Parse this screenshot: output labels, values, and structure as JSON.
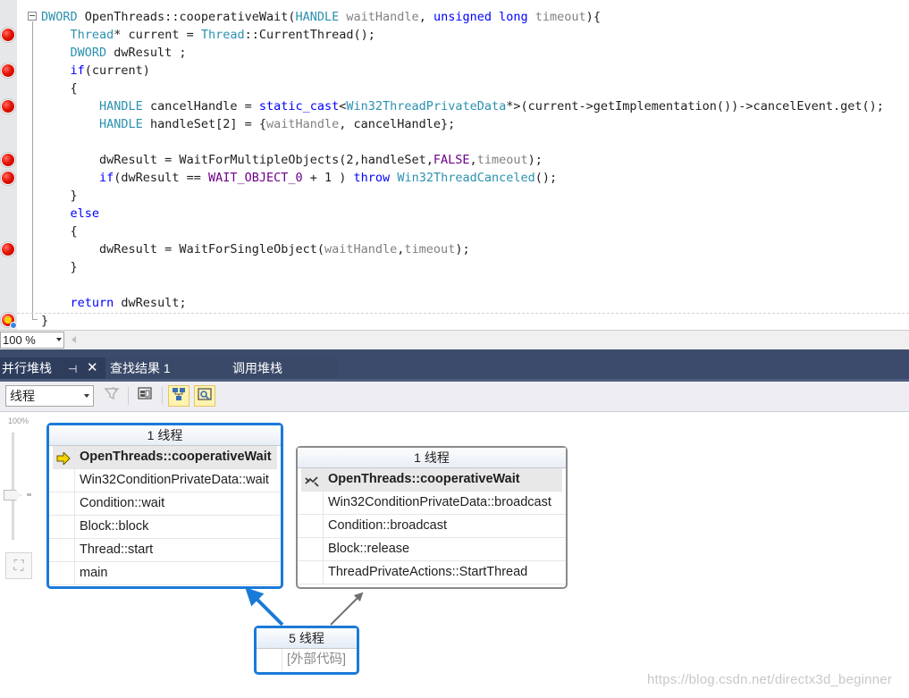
{
  "editor": {
    "lines": [
      {
        "indent": "",
        "tokens": [
          [
            "ty",
            "DWORD"
          ],
          [
            "",
            "",
            " "
          ],
          [
            "",
            "OpenThreads::cooperativeWait("
          ],
          [
            "ty",
            "HANDLE"
          ],
          [
            "",
            " "
          ],
          [
            "pa",
            "waitHandle"
          ],
          [
            "",
            ", "
          ],
          [
            "kw",
            "unsigned long"
          ],
          [
            "",
            " "
          ],
          [
            "pa",
            "timeout"
          ],
          [
            "",
            ")"
          ],
          [
            "",
            "{"
          ]
        ]
      },
      {
        "indent": "    ",
        "tokens": [
          [
            "ty",
            "Thread"
          ],
          [
            "",
            "* current = "
          ],
          [
            "ty",
            "Thread"
          ],
          [
            "",
            "::CurrentThread();"
          ]
        ]
      },
      {
        "indent": "    ",
        "tokens": [
          [
            "ty",
            "DWORD"
          ],
          [
            "",
            " dwResult ;"
          ]
        ]
      },
      {
        "indent": "    ",
        "tokens": [
          [
            "kw",
            "if"
          ],
          [
            "",
            "(current)"
          ]
        ]
      },
      {
        "indent": "    ",
        "tokens": [
          [
            "",
            "{"
          ]
        ]
      },
      {
        "indent": "        ",
        "tokens": [
          [
            "ty",
            "HANDLE"
          ],
          [
            "",
            " cancelHandle = "
          ],
          [
            "kw",
            "static_cast"
          ],
          [
            "",
            "<"
          ],
          [
            "ty",
            "Win32ThreadPrivateData"
          ],
          [
            "",
            "*>(current->getImplementation())->cancelEvent.get();"
          ]
        ]
      },
      {
        "indent": "        ",
        "tokens": [
          [
            "ty",
            "HANDLE"
          ],
          [
            "",
            " handleSet[2] = {"
          ],
          [
            "pa",
            "waitHandle"
          ],
          [
            "",
            ", cancelHandle};"
          ]
        ]
      },
      {
        "indent": "",
        "tokens": [
          [
            "",
            ""
          ]
        ]
      },
      {
        "indent": "        ",
        "tokens": [
          [
            "",
            "dwResult = WaitForMultipleObjects(2,handleSet,"
          ],
          [
            "mc",
            "FALSE"
          ],
          [
            "",
            ","
          ],
          [
            "pa",
            "timeout"
          ],
          [
            "",
            ");"
          ]
        ]
      },
      {
        "indent": "        ",
        "tokens": [
          [
            "kw",
            "if"
          ],
          [
            "",
            "(dwResult == "
          ],
          [
            "mc",
            "WAIT_OBJECT_0"
          ],
          [
            "",
            " + 1 ) "
          ],
          [
            "kw",
            "throw"
          ],
          [
            "",
            " "
          ],
          [
            "ty",
            "Win32ThreadCanceled"
          ],
          [
            "",
            "();"
          ]
        ]
      },
      {
        "indent": "    ",
        "tokens": [
          [
            "",
            "}"
          ]
        ]
      },
      {
        "indent": "    ",
        "tokens": [
          [
            "kw",
            "else"
          ]
        ]
      },
      {
        "indent": "    ",
        "tokens": [
          [
            "",
            "{"
          ]
        ]
      },
      {
        "indent": "        ",
        "tokens": [
          [
            "",
            "dwResult = WaitForSingleObject("
          ],
          [
            "pa",
            "waitHandle"
          ],
          [
            "",
            ","
          ],
          [
            "pa",
            "timeout"
          ],
          [
            "",
            ");"
          ]
        ]
      },
      {
        "indent": "    ",
        "tokens": [
          [
            "",
            "}"
          ]
        ]
      },
      {
        "indent": "",
        "tokens": [
          [
            "",
            ""
          ]
        ]
      },
      {
        "indent": "    ",
        "tokens": [
          [
            "kw",
            "return"
          ],
          [
            "",
            " dwResult;"
          ]
        ]
      },
      {
        "indent": "",
        "tokens": [
          [
            "",
            "}"
          ]
        ]
      }
    ],
    "breakpoint_lines": [
      1,
      3,
      5,
      8,
      9,
      13
    ],
    "current_line": 17,
    "zoom": "100 %"
  },
  "tabs": {
    "parallel_stacks": "并行堆栈",
    "find_results": "查找结果 1",
    "call_stack": "调用堆栈"
  },
  "toolbar": {
    "mode": "线程"
  },
  "diagram": {
    "zoom_label": "100%",
    "node_a": {
      "header": "1 线程",
      "frames": [
        "OpenThreads::cooperativeWait",
        "Win32ConditionPrivateData::wait",
        "Condition::wait",
        "Block::block",
        "Thread::start",
        "main"
      ]
    },
    "node_b": {
      "header": "1 线程",
      "frames": [
        "OpenThreads::cooperativeWait",
        "Win32ConditionPrivateData::broadcast",
        "Condition::broadcast",
        "Block::release",
        "ThreadPrivateActions::StartThread"
      ]
    },
    "node_c": {
      "header": "5 线程",
      "frames": [
        "[外部代码]"
      ]
    },
    "colors": {
      "selected": "#1a7ad8",
      "link": "#707070"
    }
  },
  "watermark": "https://blog.csdn.net/directx3d_beginner"
}
